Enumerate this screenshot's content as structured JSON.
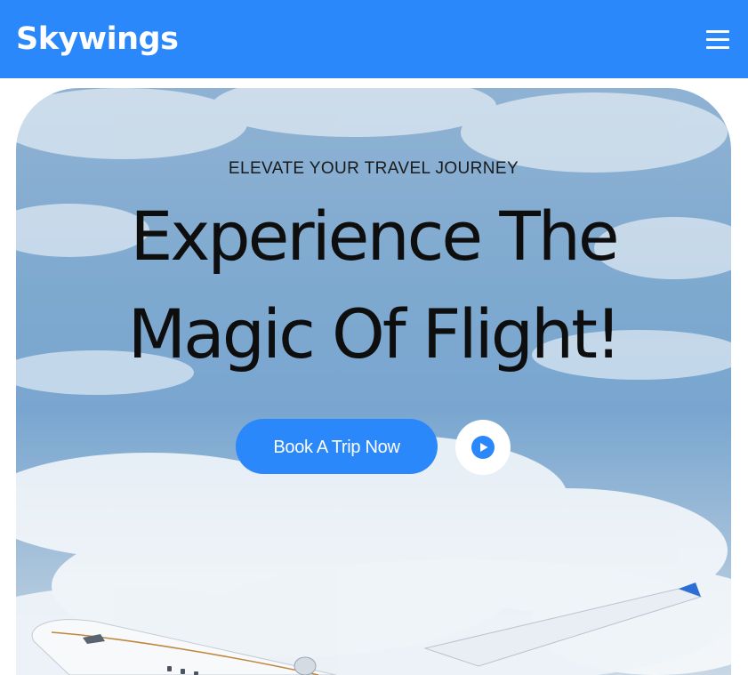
{
  "nav": {
    "logo": "Skywings",
    "menu_icon": "hamburger-menu-icon"
  },
  "hero": {
    "eyebrow": "ELEVATE YOUR TRAVEL JOURNEY",
    "headline_line1": "Experience The",
    "headline_line2": "Magic Of Flight!",
    "cta_label": "Book A Trip Now",
    "play_icon": "play-icon"
  },
  "colors": {
    "brand": "#2b88fb",
    "sky": "#7ea9cf",
    "headline": "#0e0e0e",
    "white": "#ffffff"
  }
}
